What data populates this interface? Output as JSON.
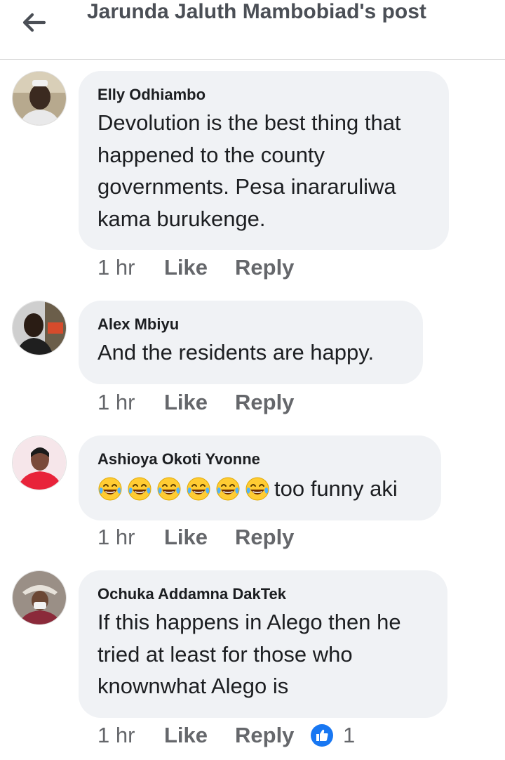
{
  "header": {
    "title": "Jarunda Jaluth Mambobiad's post"
  },
  "comments": [
    {
      "author": "Elly Odhiambo",
      "text": "Devolution is the best thing that happened to the county governments. Pesa inararuliwa kama burukenge.",
      "time": "1 hr",
      "like_label": "Like",
      "reply_label": "Reply"
    },
    {
      "author": "Alex Mbiyu",
      "text": "And the residents are happy.",
      "time": "1 hr",
      "like_label": "Like",
      "reply_label": "Reply"
    },
    {
      "author": "Ashioya Okoti Yvonne",
      "emoji_count": 6,
      "emoji_name": "face-with-tears-of-joy",
      "text": "too funny aki",
      "time": "1 hr",
      "like_label": "Like",
      "reply_label": "Reply"
    },
    {
      "author": "Ochuka Addamna DakTek",
      "text": "If this happens in Alego then he tried at least for those who knownwhat Alego is",
      "time": "1 hr",
      "like_label": "Like",
      "reply_label": "Reply",
      "reaction": {
        "icon": "like-icon",
        "count": "1"
      }
    }
  ],
  "colors": {
    "bubble": "#f0f2f5",
    "meta": "#65676b",
    "title": "#4b4f56",
    "like_blue": "#1877f2"
  }
}
